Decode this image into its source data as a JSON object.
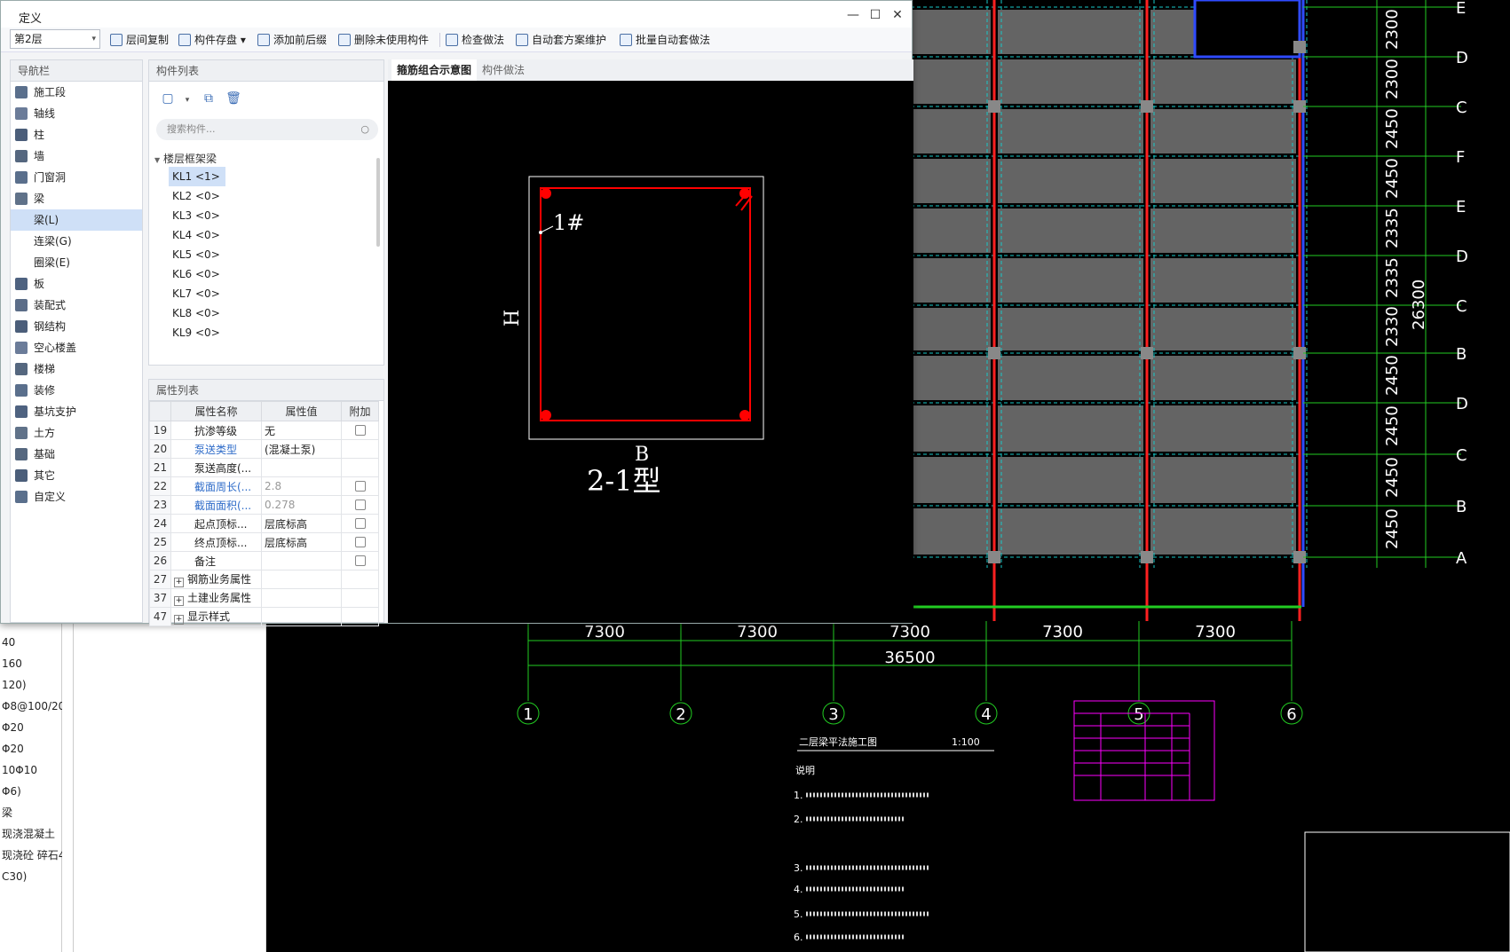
{
  "dialog": {
    "title": "定义",
    "controls": {
      "minimize": "—",
      "maximize": "☐",
      "close": "✕"
    }
  },
  "toolbar": {
    "floor": "第2层",
    "items": [
      "层间复制",
      "构件存盘",
      "添加前后缀",
      "删除未使用构件",
      "检查做法",
      "自动套方案维护",
      "批量自动套做法"
    ]
  },
  "nav": {
    "title": "导航栏",
    "items": [
      {
        "label": "施工段",
        "icon": "construction-segment-icon"
      },
      {
        "label": "轴线",
        "icon": "axis-grid-icon"
      },
      {
        "label": "柱",
        "icon": "column-icon"
      },
      {
        "label": "墙",
        "icon": "wall-icon"
      },
      {
        "label": "门窗洞",
        "icon": "door-window-icon"
      },
      {
        "label": "梁",
        "icon": "beam-icon"
      },
      {
        "label": "梁(L)",
        "icon": "",
        "sub": true,
        "active": true
      },
      {
        "label": "连梁(G)",
        "icon": "",
        "sub": true
      },
      {
        "label": "圈梁(E)",
        "icon": "",
        "sub": true
      },
      {
        "label": "板",
        "icon": "slab-icon"
      },
      {
        "label": "装配式",
        "icon": "prefab-icon"
      },
      {
        "label": "钢结构",
        "icon": "steel-structure-icon"
      },
      {
        "label": "空心楼盖",
        "icon": "hollow-floor-icon"
      },
      {
        "label": "楼梯",
        "icon": "stair-icon"
      },
      {
        "label": "装修",
        "icon": "decoration-icon"
      },
      {
        "label": "基坑支护",
        "icon": "pit-support-icon"
      },
      {
        "label": "土方",
        "icon": "earthwork-icon"
      },
      {
        "label": "基础",
        "icon": "foundation-icon"
      },
      {
        "label": "其它",
        "icon": "other-icon"
      },
      {
        "label": "自定义",
        "icon": "custom-icon"
      }
    ]
  },
  "components": {
    "title": "构件列表",
    "search_placeholder": "搜索构件...",
    "group": "楼层框架梁",
    "items": [
      "KL1 <1>",
      "KL2 <0>",
      "KL3 <0>",
      "KL4 <0>",
      "KL5 <0>",
      "KL6 <0>",
      "KL7 <0>",
      "KL8 <0>",
      "KL9 <0>"
    ]
  },
  "properties": {
    "title": "属性列表",
    "headers": [
      "属性名称",
      "属性值",
      "附加"
    ],
    "rows": [
      {
        "no": "19",
        "name": "抗渗等级",
        "value": "无",
        "style": "",
        "check": true,
        "expand": false
      },
      {
        "no": "20",
        "name": "泵送类型",
        "value": "(混凝土泵)",
        "style": "blue",
        "check": false,
        "expand": false
      },
      {
        "no": "21",
        "name": "泵送高度(...",
        "value": "",
        "style": "",
        "check": false,
        "expand": false
      },
      {
        "no": "22",
        "name": "截面周长(...",
        "value": "2.8",
        "style": "blue",
        "check": true,
        "expand": false,
        "valgrey": true
      },
      {
        "no": "23",
        "name": "截面面积(...",
        "value": "0.278",
        "style": "blue",
        "check": true,
        "expand": false,
        "valgrey": true
      },
      {
        "no": "24",
        "name": "起点顶标...",
        "value": "层底标高",
        "style": "",
        "check": true,
        "expand": false
      },
      {
        "no": "25",
        "name": "终点顶标...",
        "value": "层底标高",
        "style": "",
        "check": true,
        "expand": false
      },
      {
        "no": "26",
        "name": "备注",
        "value": "",
        "style": "",
        "check": true,
        "expand": false
      },
      {
        "no": "27",
        "name": "钢筋业务属性",
        "value": "",
        "style": "",
        "check": false,
        "expand": true
      },
      {
        "no": "37",
        "name": "土建业务属性",
        "value": "",
        "style": "",
        "check": false,
        "expand": true
      },
      {
        "no": "47",
        "name": "显示样式",
        "value": "",
        "style": "",
        "check": false,
        "expand": true
      }
    ]
  },
  "preview": {
    "tabs": [
      "箍筋组合示意图",
      "构件做法"
    ],
    "labels": {
      "bar": "1#",
      "height": "H",
      "width": "B",
      "type": "2-1型"
    }
  },
  "cad": {
    "spans": [
      "7300",
      "7300",
      "7300",
      "7300",
      "7300"
    ],
    "total_x": "36500",
    "axes_x": [
      "1",
      "2",
      "3",
      "4",
      "5",
      "6"
    ],
    "axes_y": [
      "E",
      "D",
      "C",
      "F",
      "E",
      "D",
      "C",
      "B",
      "D",
      "C",
      "B",
      "A"
    ],
    "dims_y": [
      "2300",
      "2300",
      "2450",
      "2450",
      "2335",
      "2335",
      "2330",
      "2450",
      "2450",
      "2450",
      "2450"
    ],
    "total_y": "26300",
    "plan_title": "二层梁平法施工图",
    "plan_scale": "1:100",
    "notes_title": "说明",
    "notes": [
      "1.",
      "2.",
      "3.",
      "4.",
      "5.",
      "6."
    ]
  },
  "background": {
    "left_rows": [
      "40",
      "160",
      "120)",
      "Φ8@100/20",
      "Φ20",
      "Φ20",
      "10Φ10",
      "Φ6)",
      "梁",
      "现浇混凝土",
      "现浇砼 碎石4",
      "C30)"
    ]
  },
  "colors": {
    "accent": "#2f6cc9",
    "active": "#cfe0f7",
    "rebar": "#ff0000",
    "cad_slab": "#646464"
  }
}
